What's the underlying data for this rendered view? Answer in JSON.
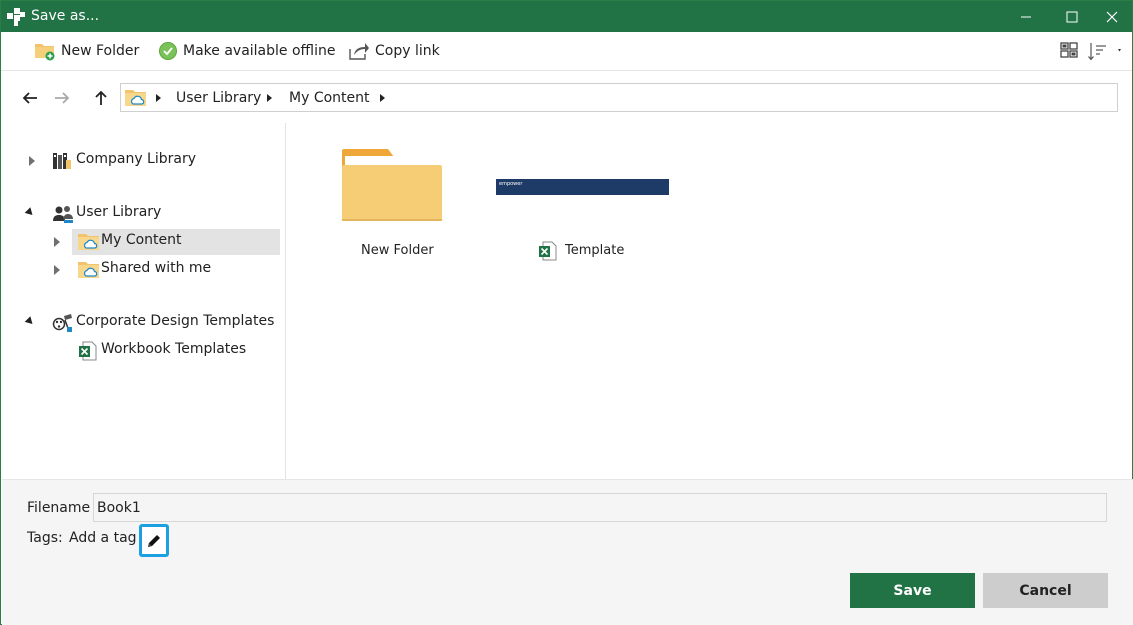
{
  "window": {
    "title": "Save as..."
  },
  "toolbar": {
    "new_folder": "New Folder",
    "make_offline": "Make available offline",
    "copy_link": "Copy link"
  },
  "breadcrumb": {
    "items": [
      "User Library",
      "My Content"
    ]
  },
  "tree": {
    "items": [
      {
        "label": "Company Library",
        "state": "collapsed",
        "icon": "company-library-icon"
      },
      {
        "label": "User Library",
        "state": "expanded",
        "icon": "user-library-icon"
      },
      {
        "label": "My Content",
        "state": "collapsed",
        "icon": "cloud-folder-icon",
        "selected": true
      },
      {
        "label": "Shared with me",
        "state": "collapsed",
        "icon": "cloud-folder-icon"
      },
      {
        "label": "Corporate Design Templates",
        "state": "expanded",
        "icon": "corporate-templates-icon"
      },
      {
        "label": "Workbook Templates",
        "state": "leaf",
        "icon": "excel-icon"
      }
    ]
  },
  "content": {
    "items": [
      {
        "label": "New Folder",
        "type": "folder"
      },
      {
        "label": "Template",
        "type": "excel-template",
        "thumbnail_text": "empower"
      }
    ]
  },
  "form": {
    "filename_label": "Filename",
    "filename_value": "Book1",
    "tags_label": "Tags:",
    "tags_placeholder": "Add a tag"
  },
  "buttons": {
    "save": "Save",
    "cancel": "Cancel"
  },
  "colors": {
    "accent": "#217346",
    "highlight": "#1ba1e2",
    "selection": "#e3e3e3"
  }
}
